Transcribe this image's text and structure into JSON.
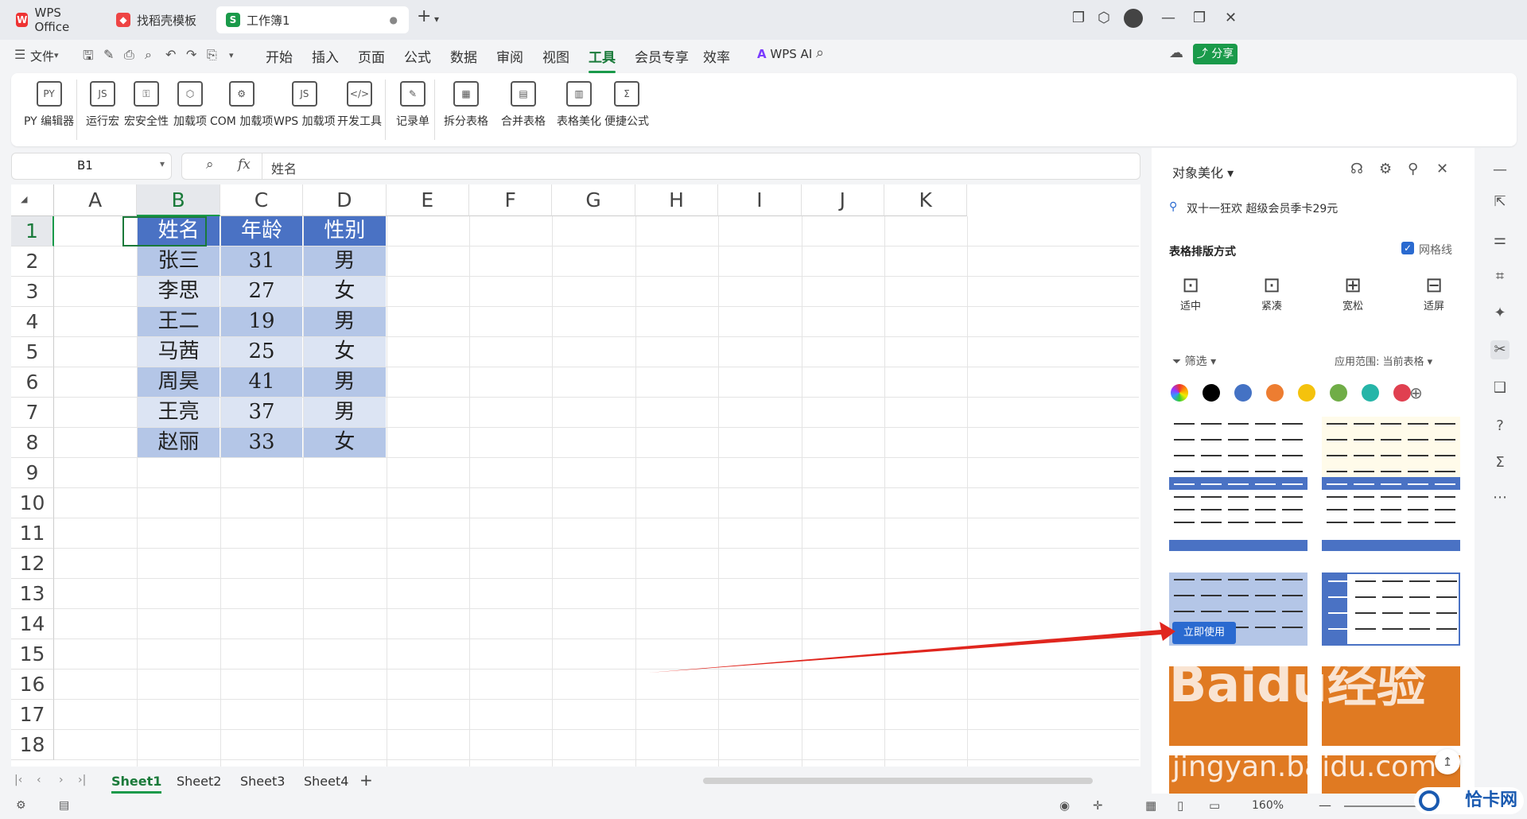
{
  "tabs": [
    {
      "label": "WPS Office",
      "icon": "wps-logo-icon"
    },
    {
      "label": "找稻壳模板",
      "icon": "docer-icon"
    },
    {
      "label": "工作簿1",
      "icon": "sheet-icon",
      "active": true
    }
  ],
  "menu": {
    "file": "文件",
    "items": [
      "开始",
      "插入",
      "页面",
      "公式",
      "数据",
      "审阅",
      "视图",
      "工具",
      "会员专享",
      "效率"
    ],
    "active": "工具",
    "wps_ai": "WPS AI",
    "share": "分享"
  },
  "ribbon": [
    {
      "label": "PY 编辑器",
      "icon": "py-editor-icon"
    },
    {
      "label": "运行宏",
      "icon": "run-macro-icon"
    },
    {
      "label": "宏安全性",
      "icon": "macro-security-icon"
    },
    {
      "label": "加载项",
      "icon": "addin-icon"
    },
    {
      "label": "COM 加载项",
      "icon": "com-addin-icon"
    },
    {
      "label": "WPS 加载项",
      "icon": "wps-addin-icon"
    },
    {
      "label": "开发工具",
      "icon": "dev-tools-icon"
    },
    {
      "label": "记录单",
      "icon": "record-form-icon"
    },
    {
      "label": "拆分表格",
      "icon": "split-table-icon"
    },
    {
      "label": "合并表格",
      "icon": "merge-table-icon"
    },
    {
      "label": "表格美化",
      "icon": "table-beautify-icon"
    },
    {
      "label": "便捷公式",
      "icon": "formula-icon"
    }
  ],
  "formula_bar": {
    "cell_ref": "B1",
    "fx": "fx",
    "content": "姓名"
  },
  "columns": [
    "A",
    "B",
    "C",
    "D",
    "E",
    "F",
    "G",
    "H",
    "I",
    "J",
    "K"
  ],
  "rows": [
    "1",
    "2",
    "3",
    "4",
    "5",
    "6",
    "7",
    "8",
    "9",
    "10",
    "11",
    "12",
    "13",
    "14",
    "15",
    "16",
    "17",
    "18"
  ],
  "table": {
    "header": [
      "姓名",
      "年龄",
      "性别"
    ],
    "rows": [
      [
        "张三",
        "31",
        "男"
      ],
      [
        "李思",
        "27",
        "女"
      ],
      [
        "王二",
        "19",
        "男"
      ],
      [
        "马茜",
        "25",
        "女"
      ],
      [
        "周昊",
        "41",
        "男"
      ],
      [
        "王亮",
        "37",
        "男"
      ],
      [
        "赵丽",
        "33",
        "女"
      ]
    ]
  },
  "sheets": [
    "Sheet1",
    "Sheet2",
    "Sheet3",
    "Sheet4"
  ],
  "active_sheet": "Sheet1",
  "status": {
    "zoom": "160%"
  },
  "panel": {
    "title": "对象美化",
    "promo": "双十一狂欢 超级会员季卡29元",
    "layout_title": "表格排版方式",
    "gridlines": "网格线",
    "layouts": [
      "适中",
      "紧凑",
      "宽松",
      "适屏"
    ],
    "filter": "筛选",
    "scope": "应用范围: 当前表格",
    "use_now": "立即使用",
    "colors": [
      "#000000",
      "#4472c4",
      "#ed7d31",
      "#f4c20d",
      "#70ad47",
      "#26b5a8",
      "#e04050"
    ]
  },
  "watermark": {
    "text": "Baidu经验",
    "url": "jingyan.baidu.com",
    "corner": "恰卡网"
  }
}
